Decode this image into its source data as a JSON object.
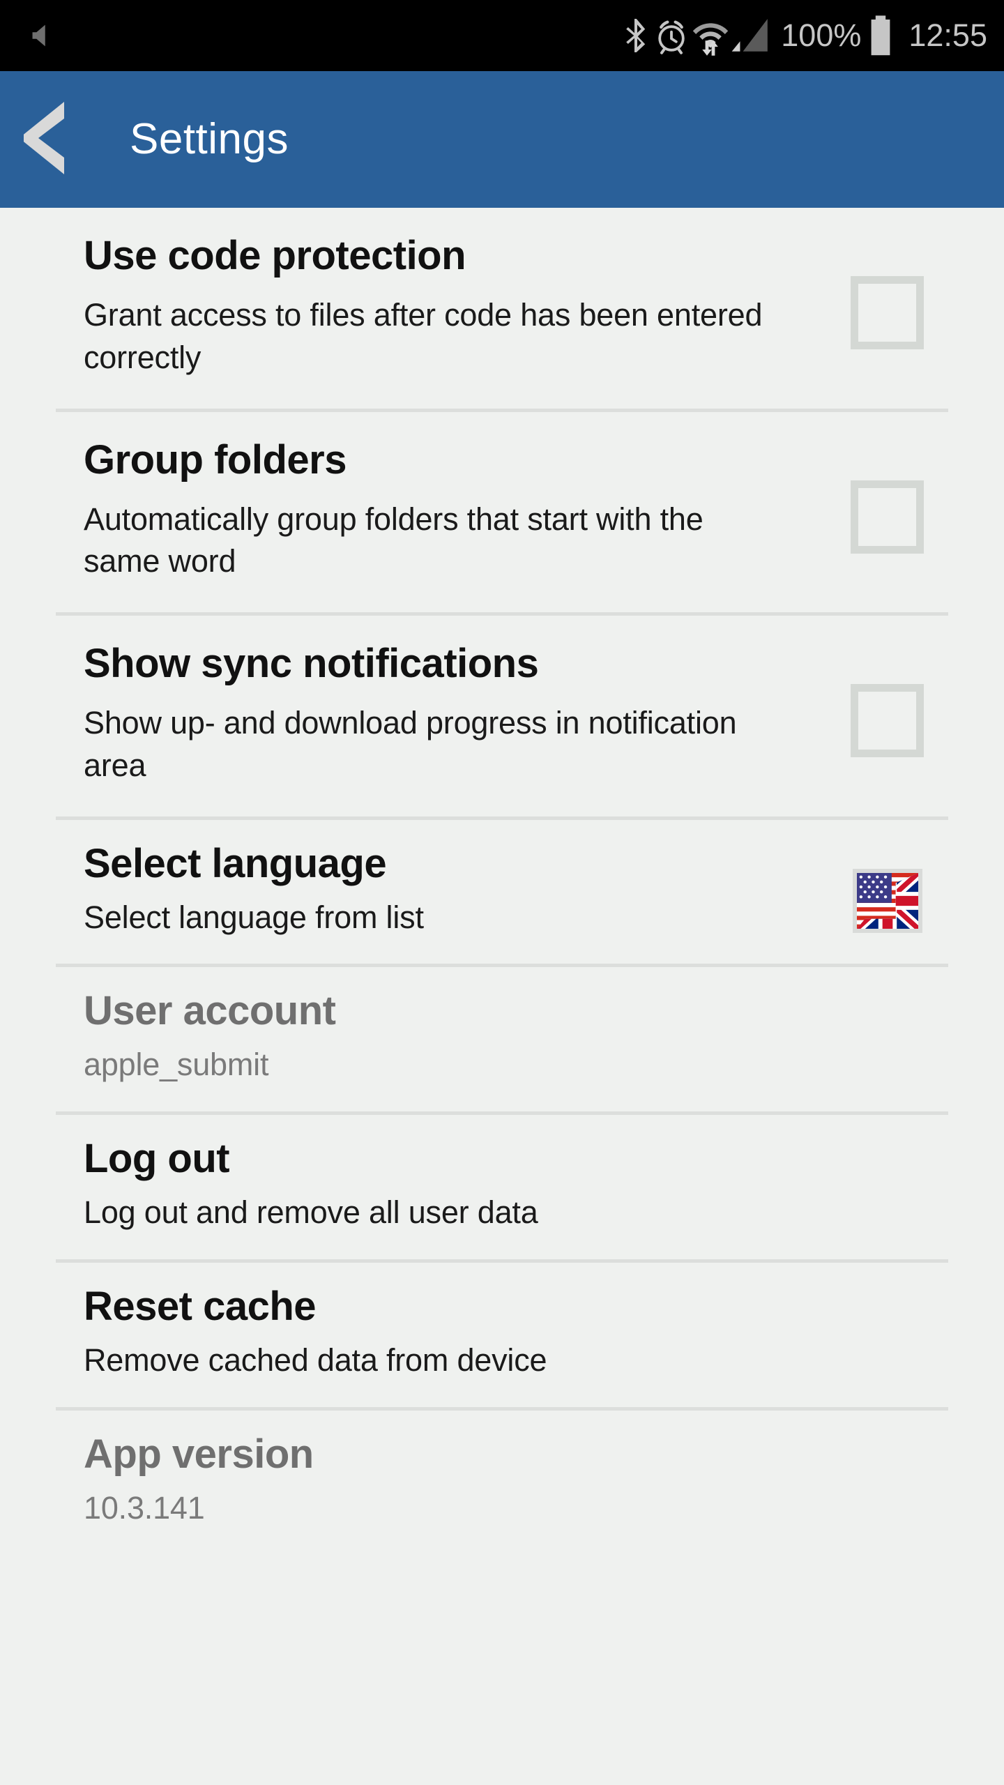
{
  "status_bar": {
    "left_icons": [
      {
        "name": "volume-mute-icon",
        "glyph": "mute"
      }
    ],
    "right_icons": [
      {
        "name": "bluetooth-icon",
        "glyph": "bluetooth"
      },
      {
        "name": "alarm-clock-icon",
        "glyph": "alarm"
      },
      {
        "name": "wifi-transfer-icon",
        "glyph": "wifi"
      },
      {
        "name": "cellular-signal-icon",
        "glyph": "signal"
      }
    ],
    "battery_percent": "100%",
    "battery_icon": "battery-full-icon",
    "clock": "12:55"
  },
  "app_bar": {
    "back_icon": "chevron-left-icon",
    "title": "Settings",
    "background_color": "#2a6099",
    "title_color": "#ffffff"
  },
  "theme": {
    "page_background": "#eff1ef",
    "divider_color": "#dcdedc",
    "checkbox_border": "#d4d8d4",
    "title_color": "#111111",
    "disabled_text_color": "#6f6f6f"
  },
  "settings": {
    "rows": [
      {
        "title": "Use code protection",
        "subtitle": "Grant access to files after code has been entered correctly",
        "accessory": "checkbox",
        "checked": false,
        "disabled": false
      },
      {
        "title": "Group folders",
        "subtitle": "Automatically group folders that start with the same word",
        "accessory": "checkbox",
        "checked": false,
        "disabled": false
      },
      {
        "title": "Show sync notifications",
        "subtitle": "Show up- and download progress in notification area",
        "accessory": "checkbox",
        "checked": false,
        "disabled": false
      },
      {
        "title": "Select language",
        "subtitle": "Select language from list",
        "accessory": "flag",
        "flag_name": "us-uk-flag-icon",
        "disabled": false
      },
      {
        "title": "User account",
        "subtitle": "apple_submit",
        "accessory": "none",
        "disabled": true
      },
      {
        "title": "Log out",
        "subtitle": "Log out and remove all user data",
        "accessory": "none",
        "disabled": false
      },
      {
        "title": "Reset cache",
        "subtitle": "Remove cached data from device",
        "accessory": "none",
        "disabled": false
      },
      {
        "title": "App version",
        "subtitle": "10.3.141",
        "accessory": "none",
        "disabled": true
      }
    ]
  }
}
